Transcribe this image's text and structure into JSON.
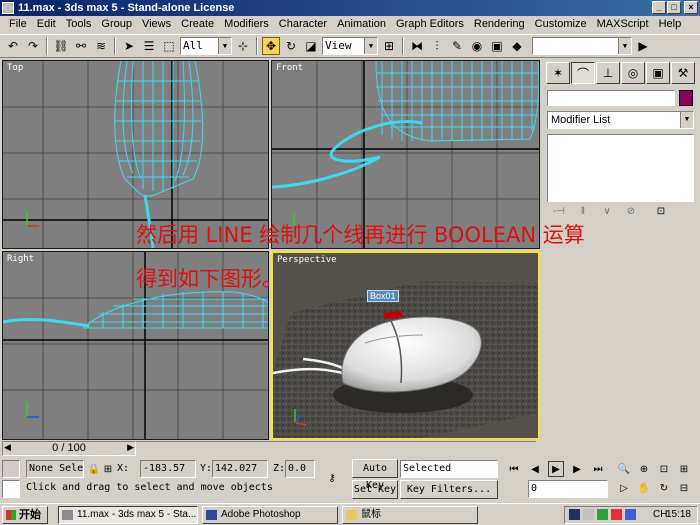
{
  "window": {
    "title": "11.max - 3ds max 5 - Stand-alone License",
    "min_label": "_",
    "max_label": "□",
    "close_label": "×"
  },
  "menu": [
    "File",
    "Edit",
    "Tools",
    "Group",
    "Views",
    "Create",
    "Modifiers",
    "Character",
    "Animation",
    "Graph Editors",
    "Rendering",
    "Customize",
    "MAXScript",
    "Help"
  ],
  "toolbar": {
    "selection_filter": "All",
    "ref_coord": "View"
  },
  "viewports": {
    "top": "Top",
    "front": "Front",
    "right": "Right",
    "perspective": "Perspective",
    "object_tag": "Box01"
  },
  "annotation": {
    "line1": "然后用 LINE 绘制几个线再进行 BOOLEAN 运算",
    "line2": "得到如下图形。"
  },
  "command_panel": {
    "modifier_list": "Modifier List",
    "object_color": "#8a0060"
  },
  "time_slider": {
    "frame_display": "0 / 100"
  },
  "status": {
    "selection": "None Sele",
    "x_label": "X:",
    "x_value": "-183.57",
    "y_label": "Y:",
    "y_value": "142.027",
    "z_label": "Z:",
    "z_value": "0.0",
    "auto_key": "Auto Key",
    "set_key": "Set Key",
    "key_mode": "Selected",
    "key_filters": "Key Filters...",
    "frame_field": "0",
    "prompt": "Click and drag to select and move objects"
  },
  "taskbar": {
    "start": "开始",
    "tasks": [
      "11.max - 3ds max 5 - Sta...",
      "Adobe Photoshop",
      "鼠标"
    ],
    "ime": "CH",
    "clock": "15:18"
  },
  "colors": {
    "wire": "#3fd7f0",
    "viewport_bg": "#7f7f7f",
    "active_border": "#f5e428",
    "annotation": "#e01010"
  }
}
